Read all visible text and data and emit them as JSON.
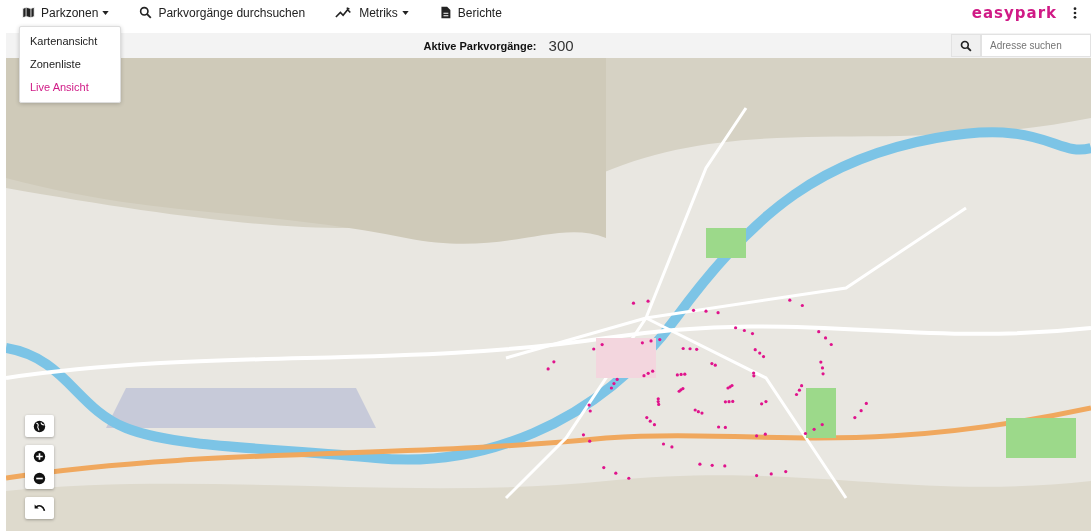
{
  "nav": [
    {
      "label": "Parkzonen",
      "kind": "map",
      "dropdown": true
    },
    {
      "label": "Parkvorgänge durchsuchen",
      "kind": "search",
      "dropdown": false
    },
    {
      "label": "Metriks",
      "kind": "trend",
      "dropdown": true
    },
    {
      "label": "Berichte",
      "kind": "doc",
      "dropdown": false
    }
  ],
  "logo": "easypark",
  "dropdown_menu": [
    {
      "label": "Kartenansicht",
      "selected": false
    },
    {
      "label": "Zonenliste",
      "selected": false
    },
    {
      "label": "Live Ansicht",
      "selected": true
    }
  ],
  "toolbar": {
    "active_label": "Aktive Parkvorgänge:",
    "active_count": "300",
    "search": {
      "placeholder": "Adresse suchen"
    }
  },
  "map_controls": [
    {
      "kind": "globe"
    },
    {
      "kind": "zoom"
    },
    {
      "kind": "reset"
    }
  ]
}
